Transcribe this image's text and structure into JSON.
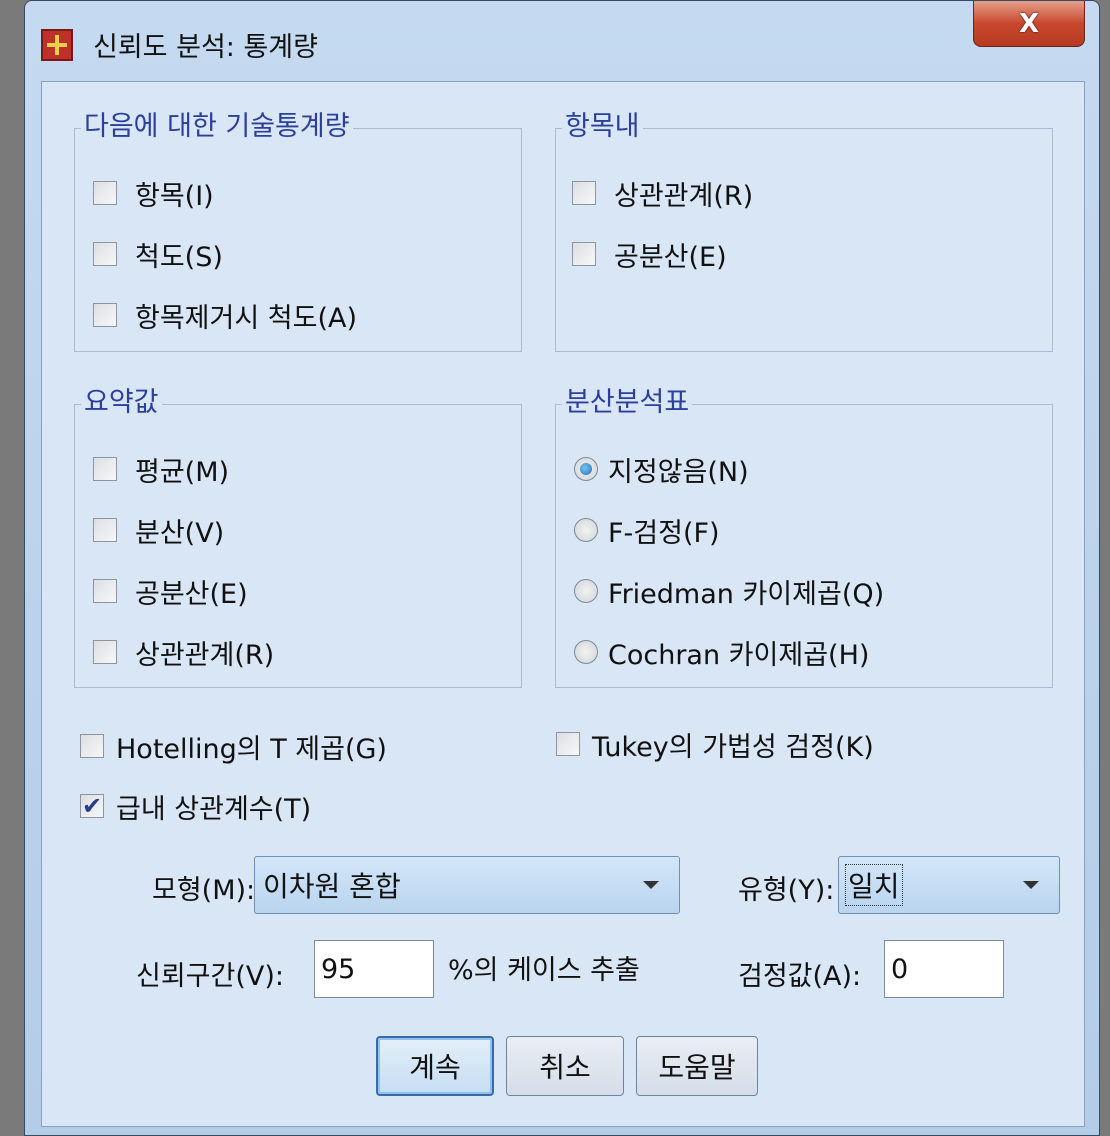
{
  "window": {
    "title": "신뢰도 분석: 통계량",
    "close_label": "X"
  },
  "groups": {
    "descriptives": {
      "label": "다음에 대한 기술통계량",
      "items": [
        {
          "label": "항목(I)",
          "checked": false
        },
        {
          "label": "척도(S)",
          "checked": false
        },
        {
          "label": "항목제거시 척도(A)",
          "checked": false
        }
      ]
    },
    "inter_item": {
      "label": "항목내",
      "items": [
        {
          "label": "상관관계(R)",
          "checked": false
        },
        {
          "label": "공분산(E)",
          "checked": false
        }
      ]
    },
    "summaries": {
      "label": "요약값",
      "items": [
        {
          "label": "평균(M)",
          "checked": false
        },
        {
          "label": "분산(V)",
          "checked": false
        },
        {
          "label": "공분산(E)",
          "checked": false
        },
        {
          "label": "상관관계(R)",
          "checked": false
        }
      ]
    },
    "anova": {
      "label": "분산분석표",
      "options": [
        {
          "label": "지정않음(N)",
          "selected": true
        },
        {
          "label": "F-검정(F)",
          "selected": false
        },
        {
          "label": "Friedman 카이제곱(Q)",
          "selected": false
        },
        {
          "label": "Cochran 카이제곱(H)",
          "selected": false
        }
      ]
    }
  },
  "hotelling": {
    "label": "Hotelling의 T 제곱(G)",
    "checked": false
  },
  "tukey": {
    "label": "Tukey의 가법성 검정(K)",
    "checked": false
  },
  "icc": {
    "label": "급내 상관계수(T)",
    "checked": true,
    "check_glyph": "✔"
  },
  "model": {
    "label": "모형(M):",
    "value": "이차원 혼합"
  },
  "type": {
    "label": "유형(Y):",
    "value": "일치"
  },
  "confidence": {
    "label": "신뢰구간(V):",
    "value": "95",
    "suffix": "%의 케이스 추출"
  },
  "test_value": {
    "label": "검정값(A):",
    "value": "0"
  },
  "buttons": {
    "continue": "계속",
    "cancel": "취소",
    "help": "도움말"
  }
}
